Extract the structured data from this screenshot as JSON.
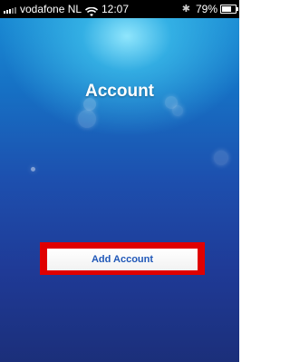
{
  "status_bar": {
    "carrier": "vodafone NL",
    "time": "12:07",
    "battery_percent": "79%",
    "icons": [
      "signal-icon",
      "wifi-icon",
      "bluetooth-icon",
      "battery-icon"
    ]
  },
  "screen": {
    "title": "Account",
    "add_account_label": "Add Account"
  },
  "colors": {
    "background_top": "#1a8fd6",
    "background_bottom": "#1b2f7a",
    "highlight": "#e00000",
    "button_text": "#1f57b8"
  }
}
